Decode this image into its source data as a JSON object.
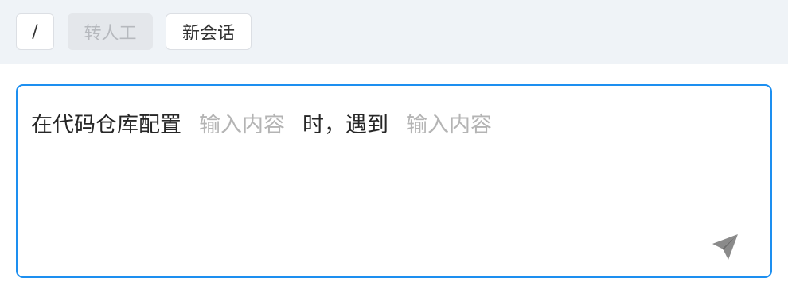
{
  "toolbar": {
    "slash_label": "/",
    "transfer_human_label": "转人工",
    "new_session_label": "新会话"
  },
  "editor": {
    "segment_1": "在代码仓库配置",
    "slot_1_placeholder": "输入内容",
    "segment_2": "时，遇到",
    "slot_2_placeholder": "输入内容",
    "send_icon": "send-icon"
  },
  "colors": {
    "accent_border": "#1d8ff0",
    "toolbar_bg": "#eff3f7",
    "placeholder": "#b4b4b4",
    "send_icon": "#8a8a8a"
  }
}
